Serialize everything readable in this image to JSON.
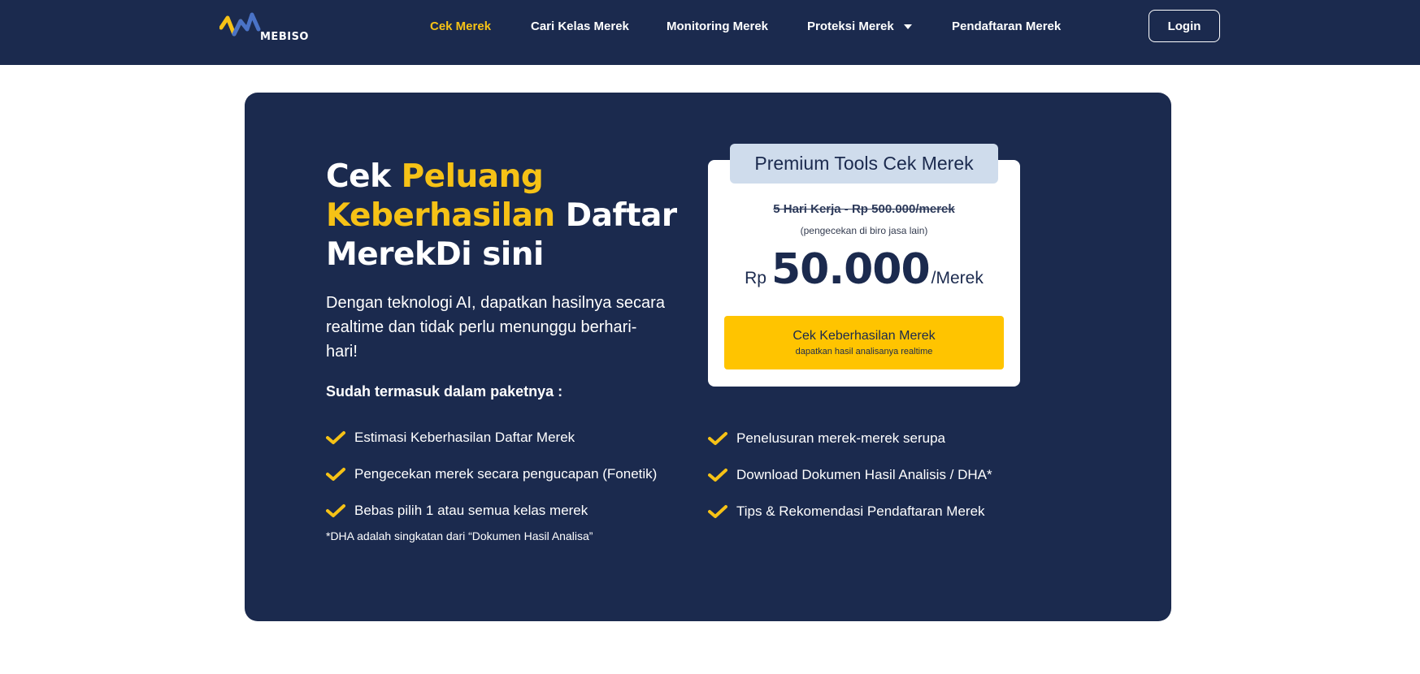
{
  "brand": {
    "name": "MEBISO",
    "colors": {
      "navy": "#1b2a4e",
      "accent": "#f6c216",
      "cta": "#ffc400",
      "tab": "#cfdcec"
    }
  },
  "nav": {
    "items": [
      {
        "label": "Cek Merek",
        "active": true
      },
      {
        "label": "Cari Kelas Merek"
      },
      {
        "label": "Monitoring Merek"
      },
      {
        "label": "Proteksi Merek",
        "dropdown": true
      },
      {
        "label": "Pendaftaran Merek"
      }
    ],
    "login_label": "Login"
  },
  "hero": {
    "title": {
      "part1": "Cek ",
      "highlight": "Peluang Keberhasilan",
      "part2": " Daftar MerekDi sini"
    },
    "description": "Dengan teknologi AI, dapatkan hasilnya secara realtime dan tidak perlu menunggu berhari-hari!",
    "package_heading": "Sudah termasuk dalam paketnya :",
    "features_left": [
      "Estimasi Keberhasilan Daftar Merek",
      "Pengecekan merek secara pengucapan (Fonetik)",
      "Bebas pilih 1 atau semua kelas merek"
    ],
    "features_right": [
      "Penelusuran merek-merek serupa",
      "Download Dokumen Hasil Analisis / DHA*",
      "Tips & Rekomendasi Pendaftaran Merek"
    ],
    "footnote": "*DHA adalah singkatan dari “Dokumen Hasil Analisa”"
  },
  "card": {
    "tab_title": "Premium Tools Cek Merek",
    "old_price": "5 Hari Kerja - Rp 500.000/merek",
    "old_price_note": "(pengecekan di biro jasa lain)",
    "currency": "Rp",
    "price": "50.000",
    "unit": "/Merek",
    "cta_label": "Cek Keberhasilan Merek",
    "cta_sublabel": "dapatkan hasil analisanya realtime"
  }
}
